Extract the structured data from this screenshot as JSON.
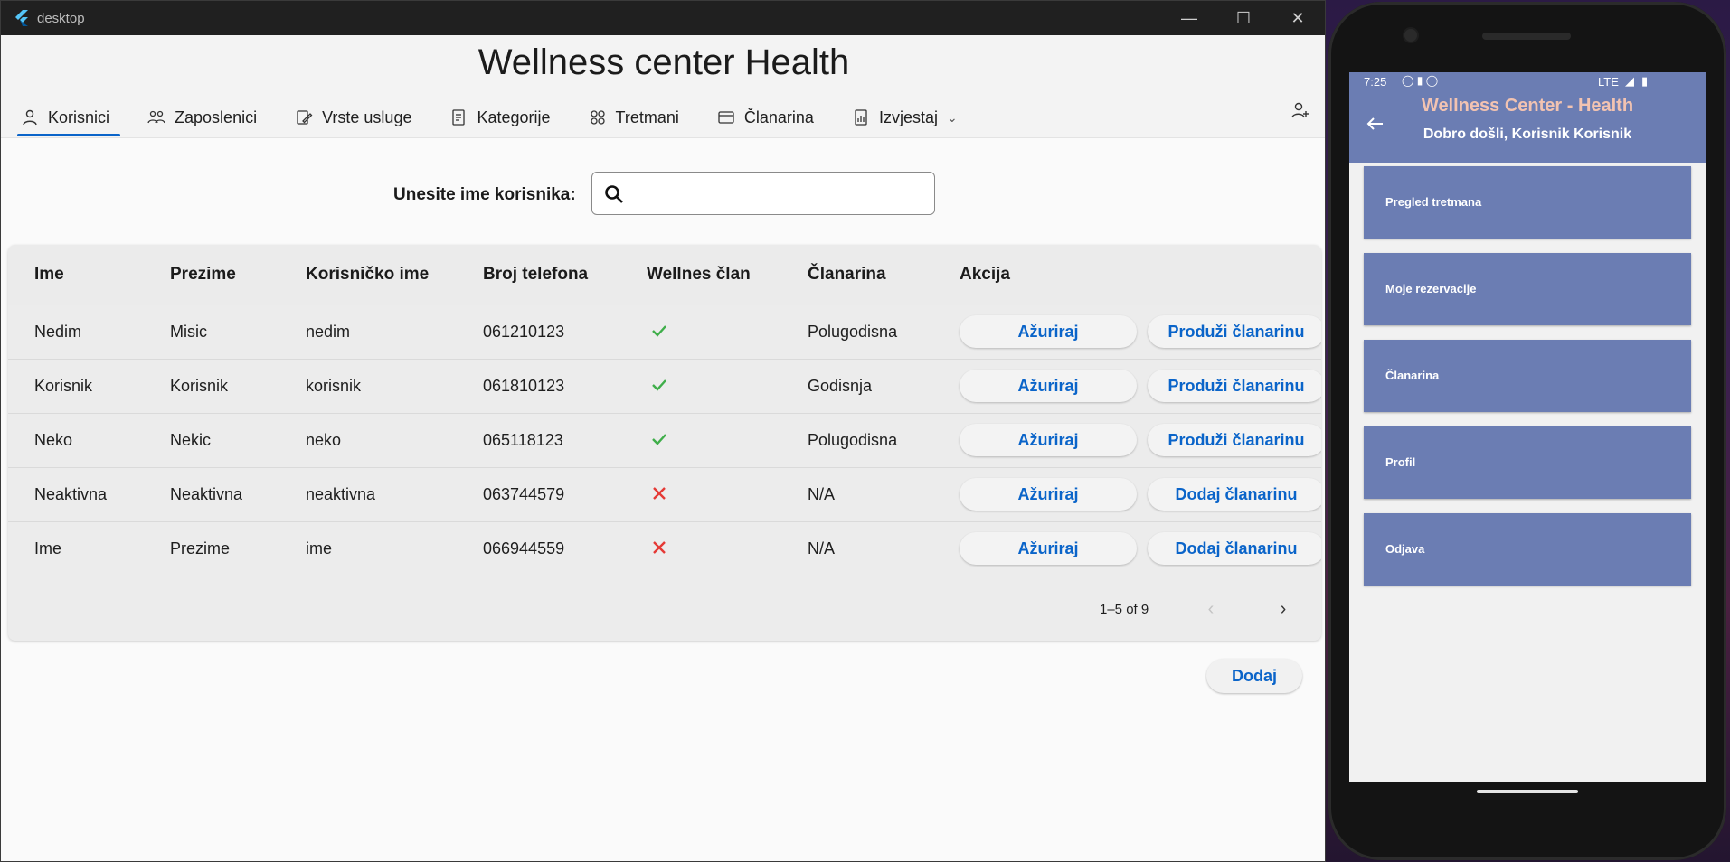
{
  "window": {
    "title": "desktop",
    "controls": [
      "minimize",
      "maximize",
      "close"
    ]
  },
  "app": {
    "title": "Wellness center Health"
  },
  "tabs": [
    {
      "label": "Korisnici",
      "icon": "person-icon",
      "active": true
    },
    {
      "label": "Zaposlenici",
      "icon": "people-icon",
      "active": false
    },
    {
      "label": "Vrste usluge",
      "icon": "edit-icon",
      "active": false
    },
    {
      "label": "Kategorije",
      "icon": "document-icon",
      "active": false
    },
    {
      "label": "Tretmani",
      "icon": "treatment-icon",
      "active": false
    },
    {
      "label": "Članarina",
      "icon": "card-icon",
      "active": false
    },
    {
      "label": "Izvjestaj",
      "icon": "report-icon",
      "active": false
    }
  ],
  "search": {
    "label": "Unesite ime korisnika:",
    "value": "",
    "placeholder": ""
  },
  "table": {
    "columns": [
      "Ime",
      "Prezime",
      "Korisničko ime",
      "Broj telefona",
      "Wellnes član",
      "Članarina",
      "Akcija"
    ],
    "rows": [
      {
        "ime": "Nedim",
        "prezime": "Misic",
        "korisnicko": "nedim",
        "telefon": "061210123",
        "clan": true,
        "clanarina": "Polugodisna",
        "btn1": "Ažuriraj",
        "btn2": "Produži članarinu"
      },
      {
        "ime": "Korisnik",
        "prezime": "Korisnik",
        "korisnicko": "korisnik",
        "telefon": "061810123",
        "clan": true,
        "clanarina": "Godisnja",
        "btn1": "Ažuriraj",
        "btn2": "Produži članarinu"
      },
      {
        "ime": "Neko",
        "prezime": "Nekic",
        "korisnicko": "neko",
        "telefon": "065118123",
        "clan": true,
        "clanarina": "Polugodisna",
        "btn1": "Ažuriraj",
        "btn2": "Produži članarinu"
      },
      {
        "ime": "Neaktivna",
        "prezime": "Neaktivna",
        "korisnicko": "neaktivna",
        "telefon": "063744579",
        "clan": false,
        "clanarina": "N/A",
        "btn1": "Ažuriraj",
        "btn2": "Dodaj članarinu"
      },
      {
        "ime": "Ime",
        "prezime": "Prezime",
        "korisnicko": "ime",
        "telefon": "066944559",
        "clan": false,
        "clanarina": "N/A",
        "btn1": "Ažuriraj",
        "btn2": "Dodaj članarinu"
      }
    ],
    "pagination": "1–5 of 9"
  },
  "add_button": "Dodaj",
  "colors": {
    "accent": "#0a64c9",
    "check": "#3fae4a",
    "cross": "#e53935",
    "mobile_primary": "#6b7db3",
    "mobile_title": "#f2c3b1"
  },
  "mobile": {
    "status": {
      "time": "7:25",
      "network": "LTE"
    },
    "title": "Wellness Center - Health",
    "subtitle": "Dobro došli, Korisnik Korisnik",
    "menu": [
      "Pregled tretmana",
      "Moje rezervacije",
      "Članarina",
      "Profil",
      "Odjava"
    ]
  }
}
